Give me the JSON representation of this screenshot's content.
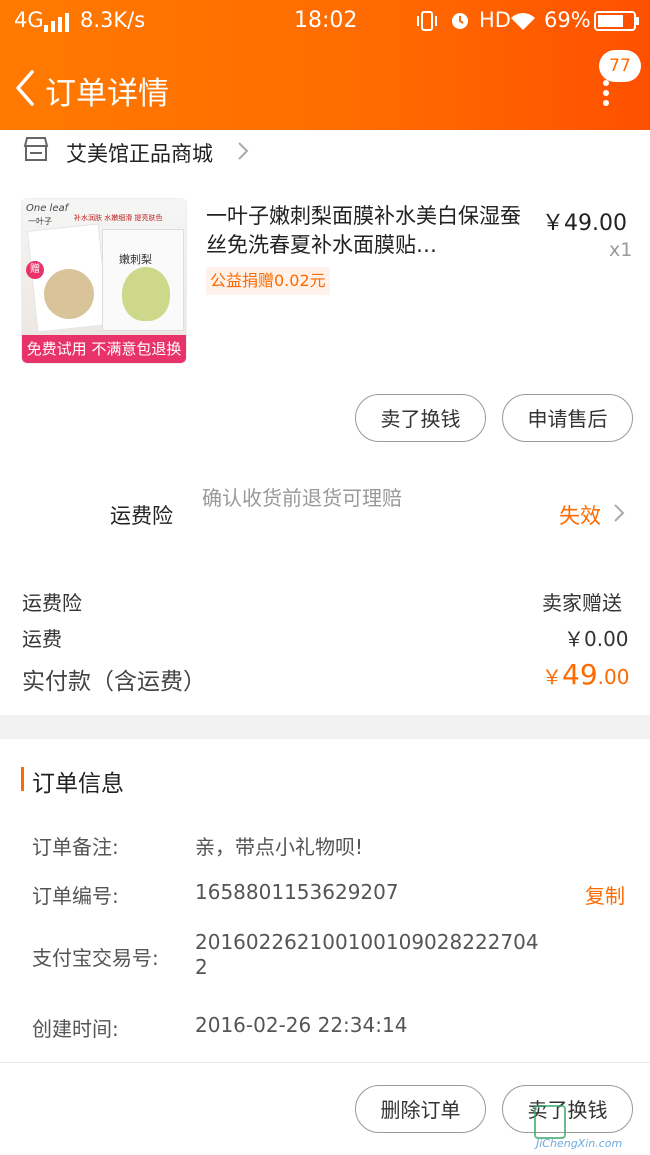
{
  "status_bar": {
    "network": "4G",
    "speed": "8.3K/s",
    "time": "18:02",
    "hd": "HD",
    "battery": "69%"
  },
  "header": {
    "title": "订单详情",
    "message_count": "77"
  },
  "shop": {
    "name": "艾美馆正品商城"
  },
  "product": {
    "brand_logo": "One leaf",
    "brand_cn": "一叶子",
    "gift_tag": "赠",
    "features": [
      "补水润肤",
      "水嫩细滑",
      "提亮肤色"
    ],
    "product_name_on_image": "嫩刺梨",
    "banner": "免费试用 不满意包退换",
    "title": "一叶子嫩刺梨面膜补水美白保湿蚕丝免洗春夏补水面膜贴…",
    "price": "￥49.00",
    "qty": "x1",
    "charity": "公益捐赠0.02元"
  },
  "item_actions": {
    "sell": "卖了换钱",
    "after_sale": "申请售后"
  },
  "insurance": {
    "label": "运费险",
    "desc": "确认收货前退货可理赔",
    "status": "失效"
  },
  "summary": {
    "insurance_label": "运费险",
    "insurance_value": "卖家赠送",
    "shipping_label": "运费",
    "shipping_value": "￥0.00",
    "paid_label": "实付款（含运费）",
    "paid_currency": "￥",
    "paid_int": "49",
    "paid_dec": ".00"
  },
  "order_info": {
    "title": "订单信息",
    "note_label": "订单备注:",
    "note_value": "亲，带点小礼物呗!",
    "id_label": "订单编号:",
    "id_value": "1658801153629207",
    "copy": "复制",
    "alipay_label": "支付宝交易号:",
    "alipay_line1": "201602262100100109028222704",
    "alipay_line2": "2",
    "created_label": "创建时间:",
    "created_value": "2016-02-26 22:34:14"
  },
  "bottom_actions": {
    "delete": "删除订单",
    "sell": "卖了换钱"
  },
  "watermark": {
    "text": "JiChengXin.com"
  },
  "colors": {
    "accent": "#ff6a00",
    "header_start": "#ff7a00",
    "header_end": "#ff5000"
  }
}
